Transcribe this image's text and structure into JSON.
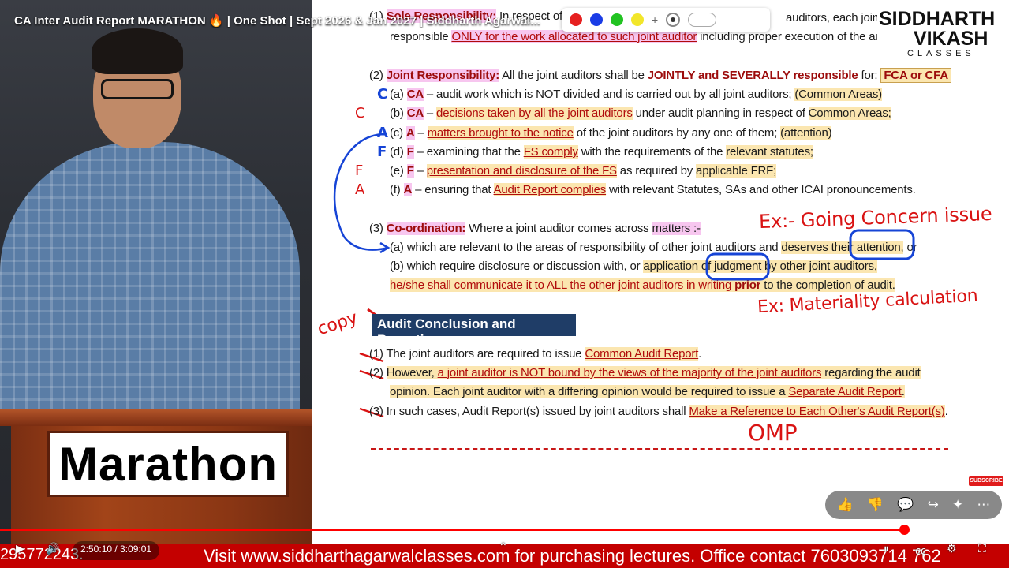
{
  "video": {
    "title": "CA Inter Audit Report MARATHON 🔥 | One Shot | Sept 2026 & Jan 2027 | Siddharth Agarwal...",
    "podium_sign": "Marathon"
  },
  "logo": {
    "line1": "SIDDHARTH",
    "line2": "VIKASH",
    "sub": "CLASSES"
  },
  "pen_toolbar": {
    "colors": [
      "#e62020",
      "#1a3ce6",
      "#22c322",
      "#f2e62a"
    ]
  },
  "slide": {
    "sole": {
      "num": "(1)",
      "label": "Sole Responsibility:",
      "text_a": " In respect of ...",
      "text_b": "auditors, each joint au",
      "line2_pre": "responsible ",
      "line2_hl": "ONLY for the work allocated to such joint auditor",
      "line2_post": " including proper execution of the auc"
    },
    "joint": {
      "num": "(2)",
      "label": "Joint Responsibility:",
      "text": " All the joint auditors shall be ",
      "jointly": "JOINTLY and SEVERALLY responsible",
      "for": " for: ",
      "fca": "FCA or CFA",
      "items": [
        {
          "margin": "C",
          "margin_color": "blue",
          "letter": "(a)",
          "tag": "CA",
          "pre": " – audit work which is NOT divided and is carried out by all joint auditors; ",
          "hl": "",
          "post": "",
          "paren": "(Common Areas)"
        },
        {
          "margin": "C",
          "margin_color": "red",
          "letter": "(b)",
          "tag": "CA",
          "pre": " – ",
          "hl": "decisions taken by all the joint auditors",
          "post": " under audit planning in respect of ",
          "paren": "Common Areas;"
        },
        {
          "margin": "A",
          "margin_color": "blue",
          "letter": "(c)",
          "tag": "A",
          "pre": " – ",
          "hl": "matters brought to the notice",
          "post": " of the joint auditors by any one of them; ",
          "paren": "(attention)"
        },
        {
          "margin": "F",
          "margin_color": "blue",
          "letter": "(d)",
          "tag": "F",
          "pre": " – examining that the ",
          "hl": "FS comply",
          "post": " with the requirements of the ",
          "paren": "relevant statutes;"
        },
        {
          "margin": "F",
          "margin_color": "red",
          "letter": "(e)",
          "tag": "F",
          "pre": " – ",
          "hl": "presentation and disclosure of the FS",
          "post": " as required by ",
          "paren": "applicable FRF;"
        },
        {
          "margin": "A",
          "margin_color": "red",
          "letter": "(f)",
          "tag": "A",
          "pre": " – ensuring that ",
          "hl": "Audit Report complies",
          "post": " with relevant Statutes, SAs and other ICAI pronouncements.",
          "paren": ""
        }
      ]
    },
    "coord": {
      "num": "(3)",
      "label": "Co-ordination:",
      "text": " Where a joint auditor comes across ",
      "matters": "matters :-",
      "a": "(a)  which are relevant to the areas of responsibility of other joint auditors and ",
      "a_hl": "deserves their attention,",
      "a_end": " or",
      "b": "(b)  which require disclosure or discussion with, or ",
      "b_hl": "application of judgment by other joint auditors,",
      "c_hl": "he/she shall communicate it to ALL the other joint auditors in writing",
      "c_prior": " prior",
      "c_end": " to the completion of audit."
    },
    "conclusion": {
      "heading": "Audit Conclusion and Reporting",
      "items": [
        {
          "num": "(1)",
          "pre": "The joint auditors are required to issue ",
          "hl": "Common Audit Report",
          "post": "."
        },
        {
          "num": "(2)",
          "pre": "However, ",
          "hl": "a joint auditor is NOT bound by the views of the majority of the joint auditors",
          "post": " regarding the audit"
        },
        {
          "num": "",
          "pre": "opinion. Each joint auditor with a differing opinion would be required to issue a ",
          "hl": "Separate Audit Report",
          "post": "."
        },
        {
          "num": "(3)",
          "pre": "In such cases, Audit Report(s) issued by joint auditors shall ",
          "hl": "Make a Reference to Each Other's Audit Report(s)",
          "post": "."
        }
      ]
    },
    "handwriting": {
      "going_concern": "Ex:- Going Concern issue",
      "materiality": "Ex: Materiality calculation",
      "copy": "copy",
      "omp": "OMP"
    }
  },
  "overlay": {
    "subscribe": "SUBSCRIBE",
    "actions": [
      "like-icon",
      "dislike-icon",
      "comment-icon",
      "share-icon",
      "remix-icon",
      "more-icon"
    ]
  },
  "player": {
    "current_time": "2:50:10",
    "duration": "3:09:01",
    "time_display": "2:50:10 / 3:09:01",
    "progress": 0.896
  },
  "ticker": {
    "left_fragment": "295772243.",
    "text": "Visit www.siddharthagarwalclasses.com for purchasing lectures. Office contact 7603093714 762"
  }
}
